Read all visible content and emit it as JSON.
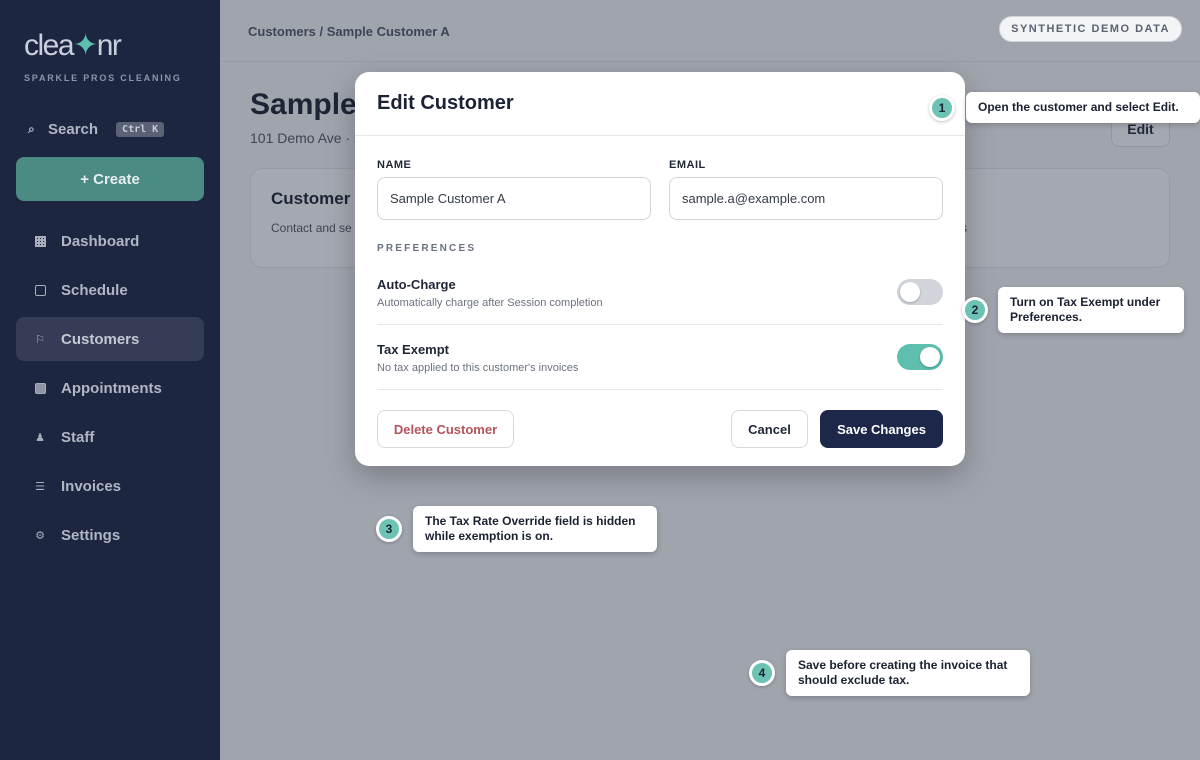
{
  "sidebar": {
    "logo_part1": "clea",
    "logo_star": "✦",
    "logo_part2": "nr",
    "tagline": "SPARKLE PROS CLEANING",
    "search_label": "Search",
    "search_shortcut": "Ctrl K",
    "create_label": "+ Create",
    "items": [
      {
        "label": "Dashboard",
        "icon": "dashboard-icon"
      },
      {
        "label": "Schedule",
        "icon": "calendar-icon"
      },
      {
        "label": "Customers",
        "icon": "customers-icon",
        "active": true
      },
      {
        "label": "Appointments",
        "icon": "appointments-icon"
      },
      {
        "label": "Staff",
        "icon": "staff-icon"
      },
      {
        "label": "Invoices",
        "icon": "invoices-icon"
      },
      {
        "label": "Settings",
        "icon": "settings-icon"
      }
    ]
  },
  "header": {
    "breadcrumb": "Customers / Sample Customer A",
    "badge": "SYNTHETIC DEMO DATA"
  },
  "background_page": {
    "title": "Sample",
    "subtitle": "101 Demo Ave · s",
    "edit_label": "Edit",
    "card_title": "Customer d",
    "card_sub": "Contact and se",
    "card_tail": "s"
  },
  "modal": {
    "title": "Edit Customer",
    "name_label": "NAME",
    "name_value": "Sample Customer A",
    "email_label": "EMAIL",
    "email_value": "sample.a@example.com",
    "preferences_label": "PREFERENCES",
    "auto_charge": {
      "title": "Auto-Charge",
      "desc": "Automatically charge after Session completion",
      "enabled": false
    },
    "tax_exempt": {
      "title": "Tax Exempt",
      "desc": "No tax applied to this customer's invoices",
      "enabled": true
    },
    "delete_label": "Delete Customer",
    "cancel_label": "Cancel",
    "save_label": "Save Changes"
  },
  "callouts": [
    {
      "num": "1",
      "text": "Open the customer and select Edit."
    },
    {
      "num": "2",
      "text": "Turn on Tax Exempt under Preferences."
    },
    {
      "num": "3",
      "text": "The Tax Rate Override field is hidden while exemption is on."
    },
    {
      "num": "4",
      "text": "Save before creating the invoice that should exclude tax."
    }
  ],
  "colors": {
    "sidebar_bg": "#1c2641",
    "accent": "#5fbfae",
    "save_button": "#1d2749",
    "delete_text": "#b5545c"
  }
}
